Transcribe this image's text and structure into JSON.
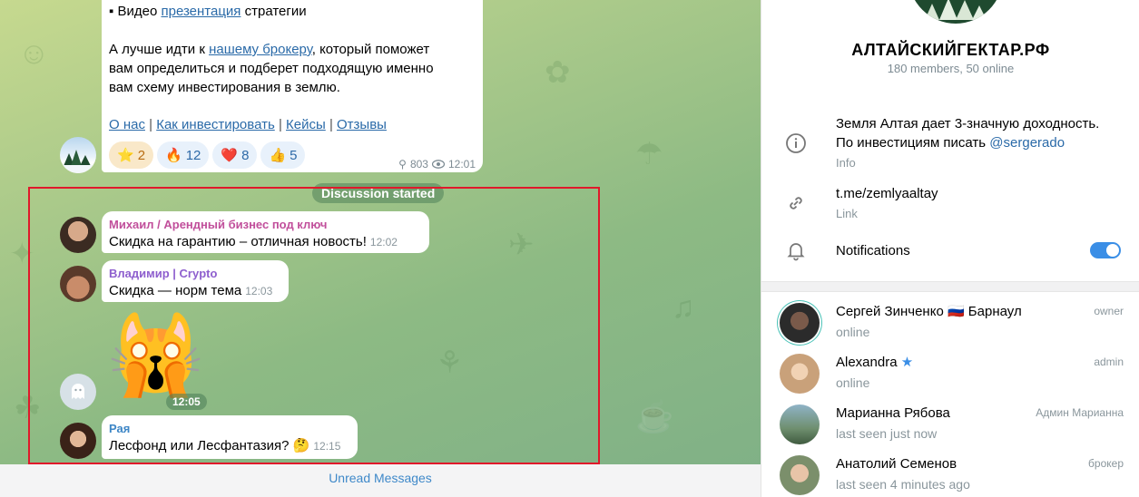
{
  "post": {
    "line0": "Видео презентация стратегии",
    "line0_prefix": "▪ Видео ",
    "line0_link": "презентация",
    "line0_suffix": " стратегии",
    "para_prefix": "А лучше идти к ",
    "para_link": "нашему брокеру",
    "para_suffix": ", который поможет",
    "para_line2": "вам определиться и подберет подходящую именно",
    "para_line3": "вам схему инвестирования в землю.",
    "links": [
      "О нас",
      "Как инвестировать",
      "Кейсы",
      "Отзывы"
    ],
    "link_separator": "|",
    "reactions": [
      {
        "emoji": "⭐",
        "count": "2"
      },
      {
        "emoji": "🔥",
        "count": "12"
      },
      {
        "emoji": "❤️",
        "count": "8"
      },
      {
        "emoji": "👍",
        "count": "5"
      }
    ],
    "views": "803",
    "time": "12:01"
  },
  "service_message": "Discussion started",
  "messages": [
    {
      "author": "Михаил / Арендный бизнес под ключ",
      "text": "Скидка на гарантию – отличная новость!",
      "time": "12:02",
      "author_color": "#c14f9b"
    },
    {
      "author": "Владимир | Crypto",
      "text": "Скидка — норм тема",
      "time": "12:03",
      "author_color": "#8e5fce"
    },
    {
      "sticker": "🙀",
      "time": "12:05"
    },
    {
      "author": "Рая",
      "text": "Лесфонд или Лесфантазия? 🤔",
      "time": "12:15",
      "author_color": "#3d86c6"
    }
  ],
  "unread_label": "Unread Messages",
  "channel": {
    "title": "АЛТАЙСКИЙГЕКТАР.РФ",
    "subtitle": "180 members, 50 online",
    "info_line1": "Земля Алтая дает 3-значную доходность.",
    "info_line2_prefix": "По инвестициям писать ",
    "info_mention": "@sergerado",
    "info_label": "Info",
    "link": "t.me/zemlyaaltay",
    "link_label": "Link",
    "notifications_label": "Notifications",
    "notifications_on": true
  },
  "members": [
    {
      "name": "Сергей Зинченко 🇷🇺 Барнаул",
      "status": "online",
      "role": "owner"
    },
    {
      "name": "Alexandra",
      "status": "online",
      "role": "admin"
    },
    {
      "name": "Марианна Рябова",
      "status": "last seen just now",
      "role": "Админ Марианна"
    },
    {
      "name": "Анатолий Семенов",
      "status": "last seen 4 minutes ago",
      "role": "брокер"
    }
  ],
  "colors": {
    "accent": "#3a8ee6",
    "highlight_border": "#e0192b",
    "link": "#2a6aa8"
  }
}
